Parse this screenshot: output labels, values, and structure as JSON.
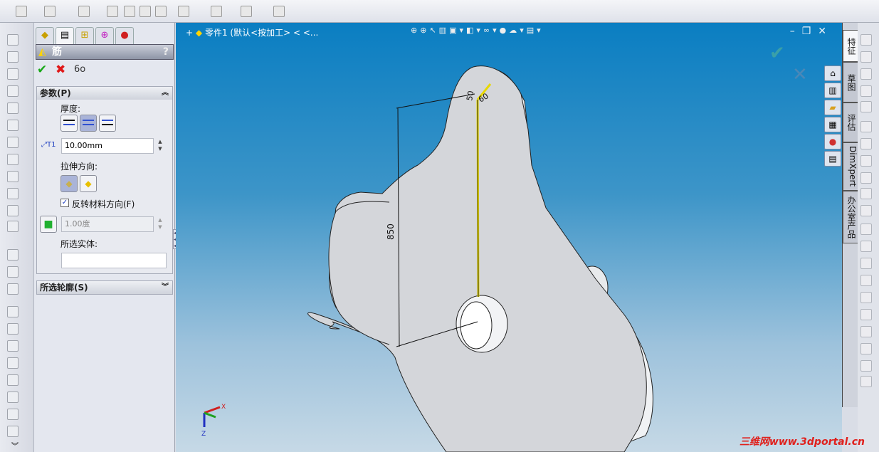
{
  "viewport": {
    "title": "零件1  (默认<按加工> < <...",
    "window_controls": [
      "minimize",
      "restore",
      "close"
    ]
  },
  "property_manager": {
    "tabs": [
      "feature-manager-icon",
      "property-manager-icon",
      "configuration-manager-icon",
      "dimxpert-icon",
      "display-manager-icon"
    ],
    "title": "筋",
    "help": "?",
    "actions": [
      "ok",
      "cancel",
      "preview"
    ],
    "params": {
      "header": "参数(P)",
      "thickness_label": "厚度:",
      "thickness_value": "10.00mm",
      "thickness_selected": "both-sides",
      "extrude_dir_label": "拉伸方向:",
      "flip_material_label": "反转材料方向(F)",
      "flip_material_checked": true,
      "draft_value": "1.00度",
      "selected_bodies_label": "所选实体:",
      "selected_bodies_value": ""
    },
    "profiles": {
      "header": "所选轮廓(S)"
    }
  },
  "command_tabs": [
    "特征",
    "草图",
    "评估",
    "DimXpert",
    "办公室产品"
  ],
  "active_command_tab": "特征",
  "task_pane": [
    "home-icon",
    "design-library-icon",
    "file-explorer-icon",
    "view-palette-icon",
    "appearances-icon",
    "custom-properties-icon"
  ],
  "sketch": {
    "dim_850": "850",
    "dim_50": "50",
    "dim_60": "60"
  },
  "watermark": "三维网www.3dportal.cn",
  "colors": {
    "viewport_top": "#0a7ec2",
    "viewport_bottom": "#c6d9e6",
    "rib_line": "#e8d800",
    "part": "#d4d6da"
  }
}
